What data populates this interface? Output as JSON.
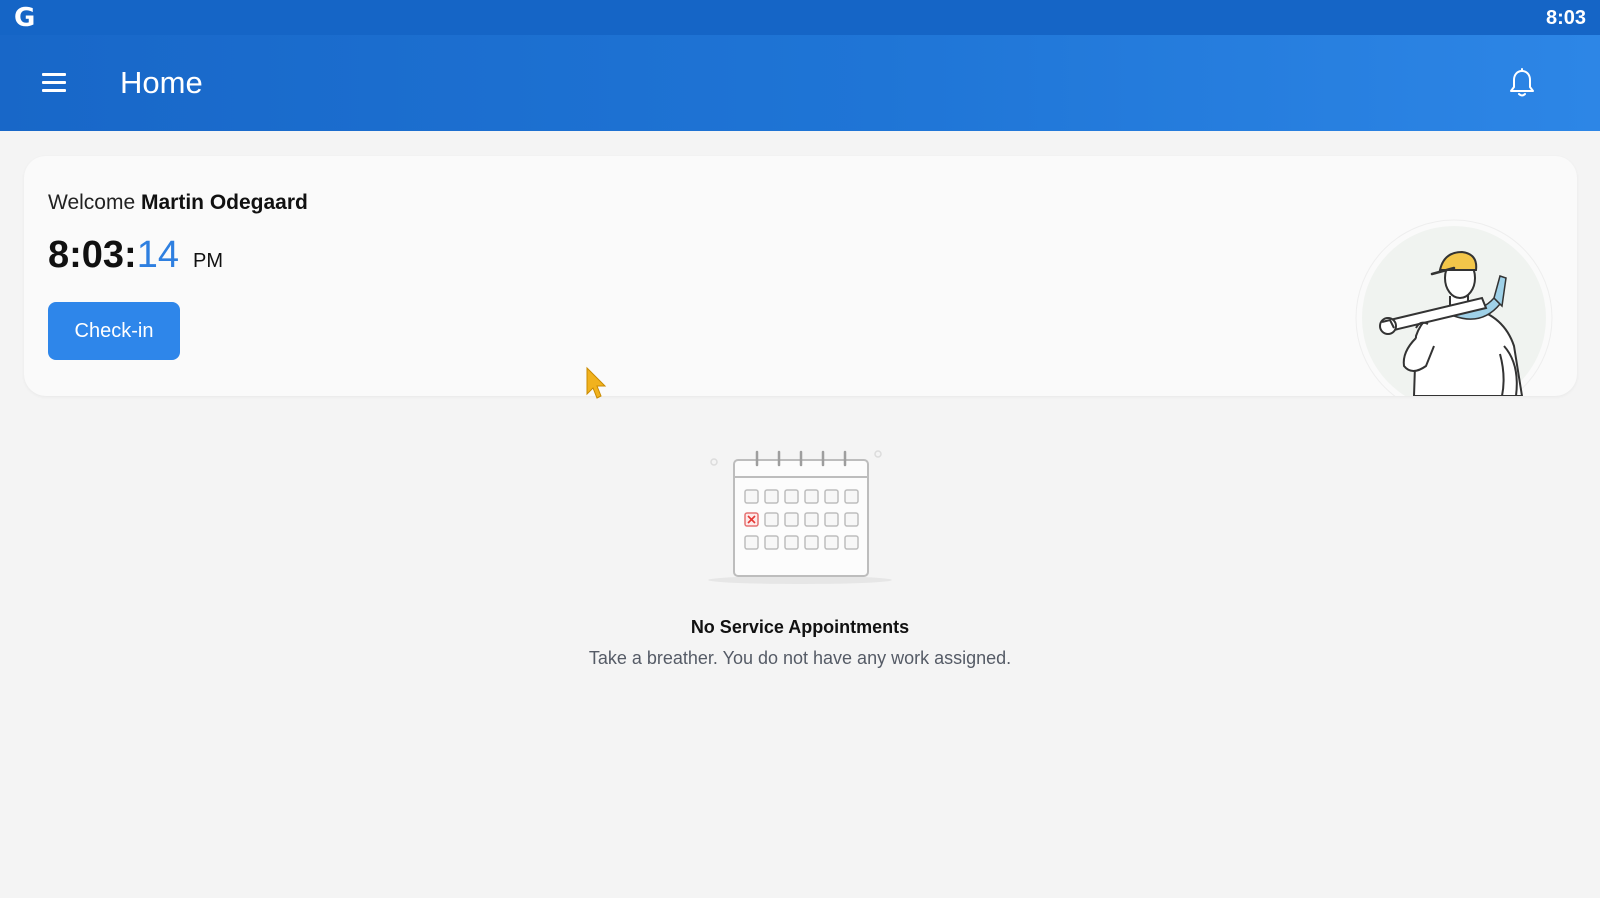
{
  "status_bar": {
    "logo": "G",
    "clock": "8:03"
  },
  "app_bar": {
    "title": "Home",
    "menu_icon": "hamburger-menu-icon",
    "notification_icon": "bell-icon"
  },
  "welcome_card": {
    "greeting": "Welcome",
    "user_name": "Martin Odegaard",
    "time_hm": "8:03:",
    "time_sec": "14",
    "time_ampm": "PM",
    "checkin_label": "Check-in",
    "illustration": "technician-with-wrench-illustration"
  },
  "empty_state": {
    "illustration": "calendar-icon",
    "title": "No Service Appointments",
    "subtitle": "Take a breather. You do not have any work assigned."
  },
  "colors": {
    "app_bar": "#1867c8",
    "primary_button": "#2e86ea",
    "seconds_accent": "#2e7fe0",
    "background": "#f4f4f4"
  }
}
